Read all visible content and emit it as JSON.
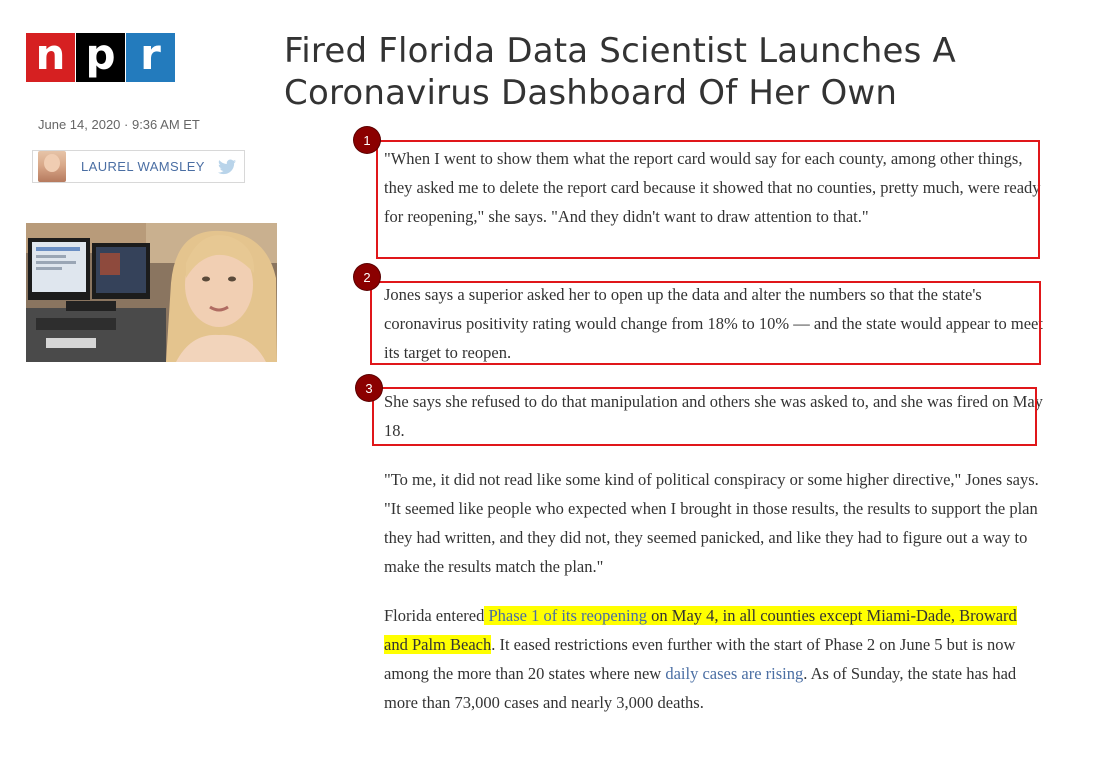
{
  "logo": {
    "letters": [
      "n",
      "p",
      "r"
    ]
  },
  "article": {
    "headline": "Fired Florida Data Scientist Launches A Coronavirus Dashboard Of Her Own",
    "dateline": "June 14, 2020 · 9:36 AM ET",
    "author": "LAUREL WAMSLEY"
  },
  "annotations": {
    "badges": [
      "1",
      "2",
      "3"
    ]
  },
  "paragraphs": {
    "p1": "\"When I went to show them what the report card would say for each county, among other things, they asked me to delete the report card because it showed that no counties, pretty much, were ready for reopening,\" she says. \"And they didn't want to draw attention to that.\"",
    "p2": "Jones says a superior asked her to open up the data and alter the numbers so that the state's coronavirus positivity rating would change from 18% to 10% — and the state would appear to meet its target to reopen.",
    "p3": "She says she refused to do that manipulation and others she was asked to, and she was fired on May 18.",
    "p4": "\"To me, it did not read like some kind of political conspiracy or some higher directive,\" Jones says. \"It seemed like people who expected when I brought in those results, the results to support the plan they had written, and they did not, they seemed panicked, and like they had to figure out a way to make the results match the plan.\"",
    "p5": {
      "s1": "Florida entered",
      "link1": " Phase 1 of its reopening",
      "s2": " on May 4, in all counties except Miami-Dade, Broward and Palm Beach",
      "s3": ". It eased restrictions even further with the start of Phase 2 on June 5 but is now among the more than 20 states where new ",
      "link2": "daily cases are rising",
      "s4": ". As of Sunday, the state has had more than 73,000 cases and nearly 3,000 deaths."
    }
  },
  "colors": {
    "highlight": "#ffff00",
    "annotation_red": "#e0171a",
    "badge": "#8b0000",
    "link": "#4a6ea3"
  }
}
